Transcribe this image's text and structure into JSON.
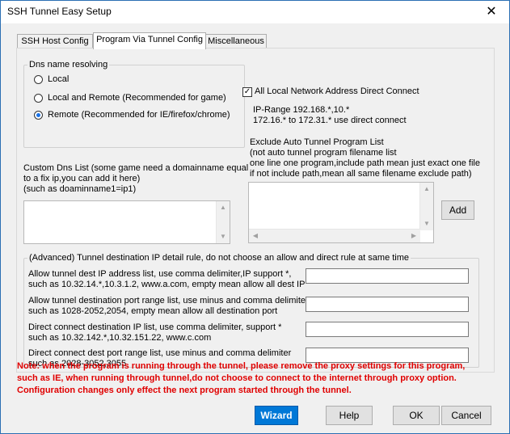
{
  "window": {
    "title": "SSH Tunnel Easy Setup",
    "close_glyph": "✕"
  },
  "tabs": [
    {
      "label": "SSH  Host Config",
      "active": false
    },
    {
      "label": "Program Via Tunnel Config",
      "active": true
    },
    {
      "label": "Miscellaneous",
      "active": false
    }
  ],
  "dns": {
    "group_title": "Dns name resolving",
    "options": [
      {
        "label": "Local",
        "selected": false
      },
      {
        "label": "Local and Remote (Recommended for game)",
        "selected": false
      },
      {
        "label": "Remote (Recommended for IE/firefox/chrome)",
        "selected": true
      }
    ]
  },
  "custom_dns": {
    "lines": [
      "Custom Dns List (some game need a domainname equal",
      " to a fix ip,you can add it here)",
      "(such as  doaminname1=ip1)"
    ]
  },
  "local_network": {
    "checkbox_label": "All Local Network Address Direct Connect",
    "checked": true,
    "checkmark": "✓",
    "ip_range_lines": [
      "IP-Range 192.168.*,10.*",
      "172.16.* to 172.31.* use direct connect"
    ]
  },
  "exclude": {
    "lines": [
      "Exclude Auto Tunnel Program List",
      "(not auto tunnel program filename list",
      "one line one program,include path mean just exact one file",
      "if not include path,mean all same filename exclude path)"
    ],
    "add_label": "Add"
  },
  "advanced": {
    "group_title": "(Advanced) Tunnel destination IP detail rule, do not choose an allow and direct rule at same time",
    "rows": [
      {
        "line1": "Allow tunnel dest IP address list, use comma delimiter,IP support *,",
        "line2": "such as 10.32.14.*,10.3.1.2, www.a.com, empty mean allow all dest IP",
        "value": ""
      },
      {
        "line1": "Allow tunnel destination port range list, use minus and comma delimiter",
        "line2": "such as 1028-2052,2054, empty mean allow all destination port",
        "value": ""
      },
      {
        "line1": "Direct connect destination IP list, use comma delimiter, support *",
        "line2": "such as 10.32.142.*,10.32.151.22, www.c.com",
        "value": ""
      },
      {
        "line1": "Direct connect dest port range list, use minus and comma delimiter",
        "line2": "such as 2028-3052,3055",
        "value": ""
      }
    ]
  },
  "note": {
    "lines": [
      "Note: when the program is running through the tunnel, please remove the proxy settings for this program,",
      "such as IE, when running through tunnel,do not choose to connect to the internet through proxy option.",
      "Configuration changes only effect the next program started through the tunnel."
    ]
  },
  "buttons": {
    "wizard": "Wizard",
    "help": "Help",
    "ok": "OK",
    "cancel": "Cancel"
  },
  "colors": {
    "accent": "#0078d7",
    "note_red": "#e00000",
    "window_border": "#2b6fb3"
  }
}
